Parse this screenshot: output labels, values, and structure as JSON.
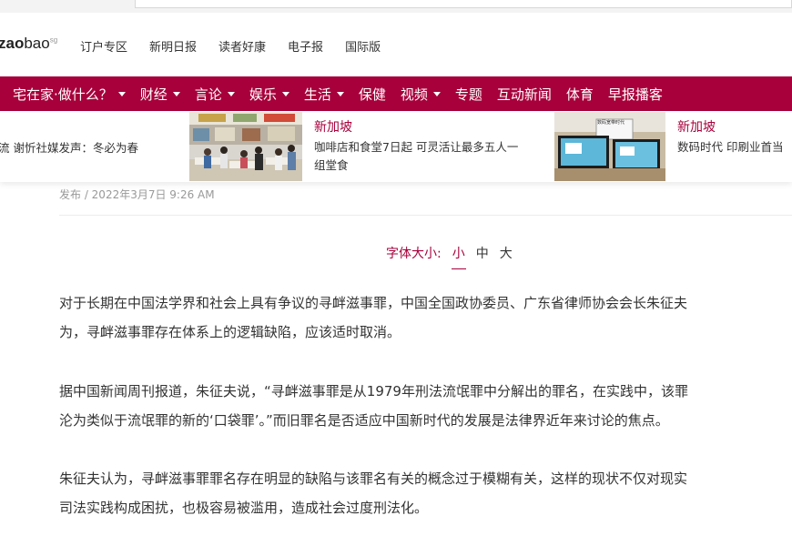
{
  "header": {
    "logo_text_bold": "zao",
    "logo_text_light": "bao",
    "logo_sup": "sg",
    "links": [
      "订户专区",
      "新明日报",
      "读者好康",
      "电子报",
      "国际版"
    ]
  },
  "nav": {
    "items": [
      {
        "label": "宅在家·做什么？",
        "dropdown": true
      },
      {
        "label": "财经",
        "dropdown": true
      },
      {
        "label": "言论",
        "dropdown": true
      },
      {
        "label": "娱乐",
        "dropdown": true
      },
      {
        "label": "生活",
        "dropdown": true
      },
      {
        "label": "保健",
        "dropdown": false
      },
      {
        "label": "视频",
        "dropdown": true
      },
      {
        "label": "专题",
        "dropdown": false
      },
      {
        "label": "互动新闻",
        "dropdown": false
      },
      {
        "label": "体育",
        "dropdown": false
      },
      {
        "label": "早报播客",
        "dropdown": false
      }
    ],
    "bg_color": "#a7003b"
  },
  "ticker": {
    "left_text": "流 谢忻社媒发声：冬必为春",
    "card1": {
      "category": "新加坡",
      "line1": "咖啡店和食堂7日起 可灵活让最多五人一",
      "line2": "组堂食"
    },
    "card2": {
      "category": "新加坡",
      "line1": "数码时代 印刷业首当",
      "thumb_caption": "数码宽带时代"
    }
  },
  "article": {
    "meta": "发布 / 2022年3月7日 9:26 AM",
    "fontsize_label": "字体大小:",
    "fontsize_options": [
      "小",
      "中",
      "大"
    ],
    "fontsize_selected": "小",
    "paragraphs": [
      [
        "对于长期在中国法学界和社会上具有争议的寻衅滋事罪，中国全国政协委员、广东省律师协会会长朱征夫",
        "为，寻衅滋事罪存在体系上的逻辑缺陷，应该适时取消。"
      ],
      [
        "据中国新闻周刊报道，朱征夫说，“寻衅滋事罪是从1979年刑法流氓罪中分解出的罪名，在实践中，该罪",
        "沦为类似于流氓罪的新的‘口袋罪’。”而旧罪名是否适应中国新时代的发展是法律界近年来讨论的焦点。"
      ],
      [
        "朱征夫认为，寻衅滋事罪罪名存在明显的缺陷与该罪名有关的概念过于模糊有关，这样的现状不仅对现实",
        "司法实践构成困扰，也极容易被滥用，造成社会过度刑法化。"
      ]
    ]
  }
}
